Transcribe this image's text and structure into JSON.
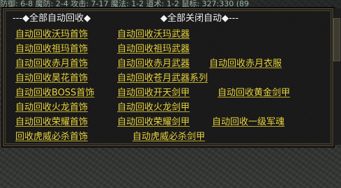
{
  "status_bar": {
    "text": "防御: 6-8 魔防: 2-4 攻击: 7-17 魔法: 1-2 道术: 1-2 鼠标: 327:330 (89"
  },
  "header": {
    "left": "---◆全部自动回收◆",
    "right": "◆全部关闭自动◆---"
  },
  "menu": {
    "rows": [
      [
        "自动回收沃玛首饰",
        "自动回收沃玛武器",
        ""
      ],
      [
        "自动回收祖玛首饰",
        "自动回收祖玛武器",
        ""
      ],
      [
        "自动回收赤月首饰",
        "自动回收赤月武器",
        "自动回收赤月衣服"
      ],
      [
        "自动回收昊花首饰",
        "自动回收苍月武器系列",
        ""
      ],
      [
        "自动回收BOSS首饰",
        "自动回收开天剑甲",
        "自动回收黄金剑甲"
      ],
      [
        "自动回收火龙首饰",
        "自动回收火龙剑甲",
        ""
      ],
      [
        "自动回收荣耀首饰",
        "自动回收荣耀剑甲",
        "自动回收一级军魂"
      ],
      [
        "回收虎威必杀首饰",
        "自动虎威必杀剑甲",
        ""
      ]
    ]
  }
}
